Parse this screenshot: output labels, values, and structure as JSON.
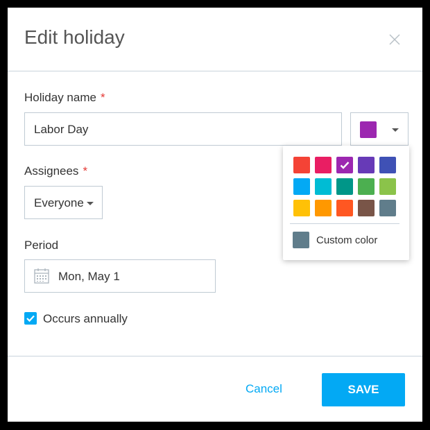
{
  "dialog": {
    "title": "Edit holiday",
    "close_icon": "close-icon"
  },
  "holiday_name": {
    "label": "Holiday name",
    "required_mark": "*",
    "value": "Labor Day",
    "selected_color": "#9c27b0"
  },
  "assignees": {
    "label": "Assignees",
    "required_mark": "*",
    "value": "Everyone"
  },
  "period": {
    "label": "Period",
    "value": "Mon, May 1",
    "icon": "calendar-icon"
  },
  "occurs_annually": {
    "label": "Occurs annually",
    "checked": true
  },
  "color_picker": {
    "colors": [
      [
        "#f44336",
        "#e91e63",
        "#9c27b0",
        "#673ab7",
        "#3f51b5"
      ],
      [
        "#03a9f4",
        "#00bcd4",
        "#009688",
        "#4caf50",
        "#8bc34a"
      ],
      [
        "#ffc107",
        "#ff9800",
        "#ff5722",
        "#795548",
        "#607d8b"
      ]
    ],
    "selected": "#9c27b0",
    "custom_label": "Custom color",
    "custom_color": "#607d8b"
  },
  "footer": {
    "cancel_label": "Cancel",
    "save_label": "SAVE"
  }
}
